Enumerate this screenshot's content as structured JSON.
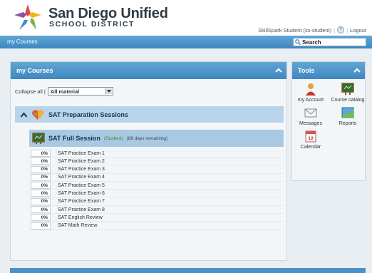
{
  "brand": {
    "name": "San Diego Unified",
    "subtitle": "SCHOOL DISTRICT"
  },
  "user_area": {
    "user": "SkillSpark Student (ss-student)",
    "logout": "Logout"
  },
  "navbar": {
    "link": "my Courses",
    "search_label": "Search"
  },
  "courses_panel": {
    "title": "my Courses",
    "collapse_all": "Collapse all |",
    "filter_value": "All material",
    "group": {
      "name": "SAT Preparation Sessions"
    },
    "course": {
      "name": "SAT Full Session",
      "status": "(Student)",
      "remaining": "(89 days remaining)"
    },
    "items": [
      {
        "pct": "0%",
        "name": "SAT Practice Exam 1"
      },
      {
        "pct": "0%",
        "name": "SAT Practice Exam 2"
      },
      {
        "pct": "0%",
        "name": "SAT Practice Exam 3"
      },
      {
        "pct": "0%",
        "name": "SAT Practice Exam 4"
      },
      {
        "pct": "0%",
        "name": "SAT Practice Exam 5"
      },
      {
        "pct": "0%",
        "name": "SAT Practice Exam 6"
      },
      {
        "pct": "0%",
        "name": "SAT Practice Exam 7"
      },
      {
        "pct": "0%",
        "name": "SAT Practice Exam 8"
      },
      {
        "pct": "0%",
        "name": "SAT English Review"
      },
      {
        "pct": "0%",
        "name": "SAT Math Review"
      }
    ]
  },
  "tools_panel": {
    "title": "Tools",
    "tools": [
      {
        "label": "my Account",
        "icon": "account-icon"
      },
      {
        "label": "Course catalog",
        "icon": "catalog-icon"
      },
      {
        "label": "Messages",
        "icon": "envelope-icon"
      },
      {
        "label": "Reports",
        "icon": "chart-icon"
      },
      {
        "label": "Calendar",
        "icon": "calendar-icon"
      }
    ],
    "calendar_day": "12"
  },
  "colors": {
    "header_blue": "#4d90c6",
    "group_row": "#b9d3e8",
    "course_row": "#a9c9e2",
    "status_green": "#2e8b2e"
  }
}
